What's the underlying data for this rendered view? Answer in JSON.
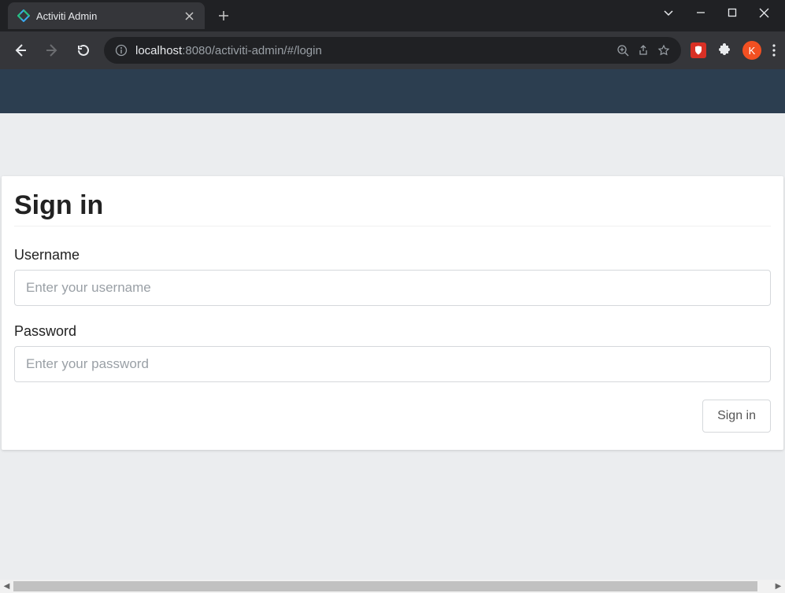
{
  "browser": {
    "tab_title": "Activiti Admin",
    "url_host": "localhost",
    "url_port_path": ":8080/activiti-admin/#/login",
    "profile_initial": "K"
  },
  "login": {
    "heading": "Sign in",
    "username_label": "Username",
    "username_placeholder": "Enter your username",
    "username_value": "",
    "password_label": "Password",
    "password_placeholder": "Enter your password",
    "password_value": "",
    "submit_label": "Sign in"
  }
}
